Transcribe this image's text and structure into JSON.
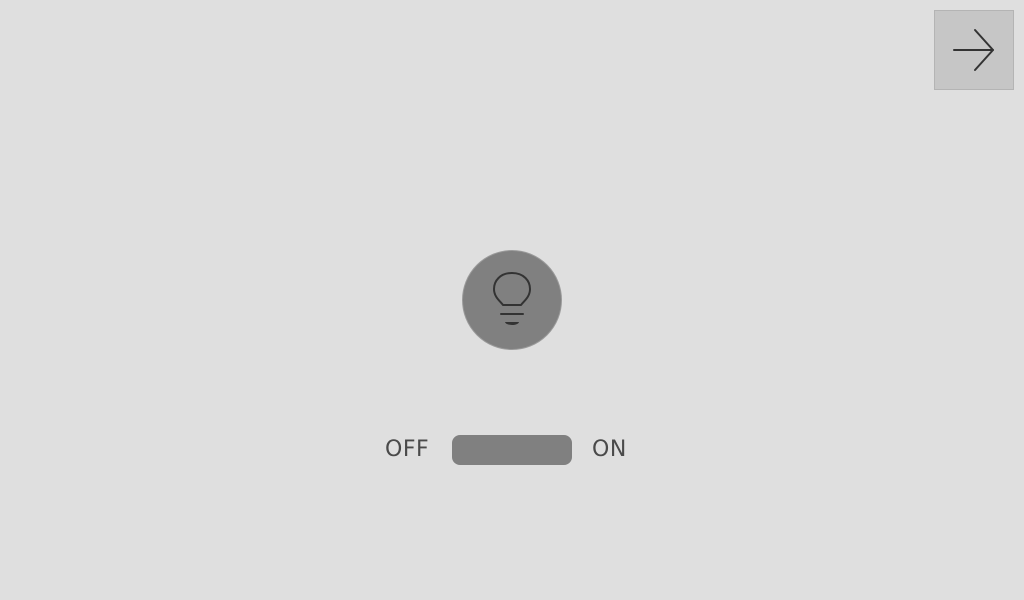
{
  "navigation": {
    "next_icon": "arrow-right-icon"
  },
  "light": {
    "icon": "lightbulb-icon",
    "colors": {
      "background": "#dfdfdf",
      "bulb_button": "#808080",
      "switch_track": "#808080"
    }
  },
  "switch": {
    "off_label": "OFF",
    "on_label": "ON"
  }
}
